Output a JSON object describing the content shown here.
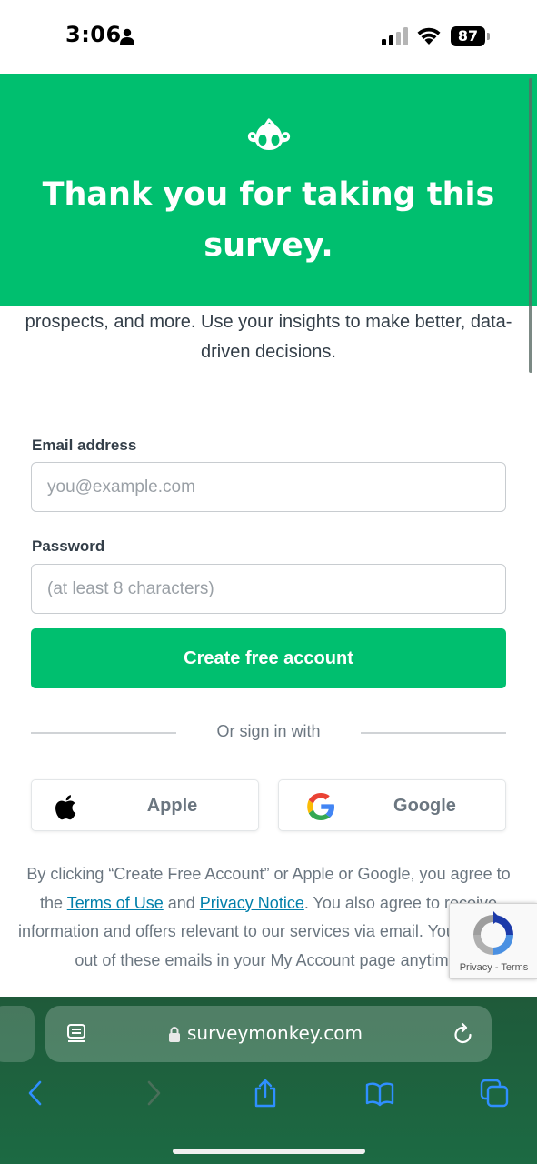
{
  "status_bar": {
    "time": "3:06",
    "battery": "87"
  },
  "hero": {
    "title": "Thank you for taking this survey."
  },
  "intro_text": "prospects, and more. Use your insights to make better, data-driven decisions.",
  "form": {
    "email_label": "Email address",
    "email_placeholder": "you@example.com",
    "email_value": "",
    "password_label": "Password",
    "password_placeholder": "(at least 8 characters)",
    "password_value": "",
    "submit_label": "Create free account"
  },
  "divider_text": "Or sign in with",
  "social": {
    "apple_label": "Apple",
    "google_label": "Google"
  },
  "legal": {
    "part1": "By clicking “Create Free Account” or Apple or Google, you agree to the ",
    "terms_link": "Terms of Use",
    "part2": " and ",
    "privacy_link": "Privacy Notice",
    "part3": ". You also agree to receive information and offers relevant to our services via email. You can opt-out of these emails in your My Account page anytime."
  },
  "recaptcha": {
    "privacy": "Privacy",
    "separator": " - ",
    "terms": "Terms"
  },
  "browser": {
    "url": "surveymonkey.com"
  },
  "colors": {
    "brand_green": "#00bf6f",
    "link_blue": "#007faa",
    "browser_icon_blue": "#2f8fff"
  },
  "icons": [
    "person-icon",
    "signal-icon",
    "wifi-icon",
    "battery-icon",
    "surveymonkey-logo",
    "apple-icon",
    "google-icon",
    "recaptcha-icon",
    "reader-icon",
    "lock-icon",
    "reload-icon",
    "back-icon",
    "forward-icon",
    "share-icon",
    "bookmarks-icon",
    "tabs-icon"
  ]
}
